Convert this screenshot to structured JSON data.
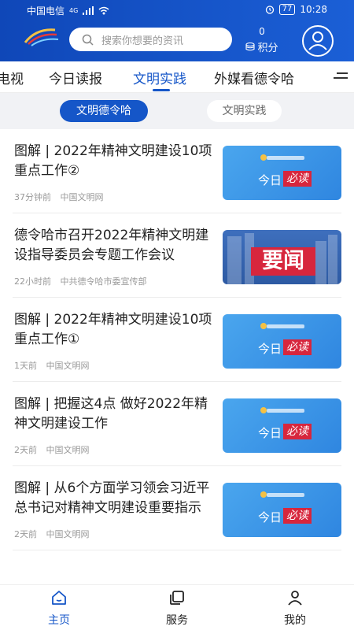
{
  "status_bar": {
    "carrier": "中国电信",
    "network": "4G",
    "battery": "77",
    "time": "10:28"
  },
  "header": {
    "search_placeholder": "搜索你想要的资讯",
    "points_value": "0",
    "points_label": "积分"
  },
  "nav": {
    "tabs": [
      {
        "label": "电视",
        "active": false
      },
      {
        "label": "今日读报",
        "active": false
      },
      {
        "label": "文明实践",
        "active": true
      },
      {
        "label": "外媒看德令哈",
        "active": false
      }
    ]
  },
  "subtabs": [
    {
      "label": "文明德令哈",
      "active": true
    },
    {
      "label": "文明实践",
      "active": false
    }
  ],
  "news": [
    {
      "title": "图解 | 2022年精神文明建设10项重点工作②",
      "time": "37分钟前",
      "source": "中国文明网",
      "thumb": "daily"
    },
    {
      "title": "德令哈市召开2022年精神文明建设指导委员会专题工作会议",
      "time": "22小时前",
      "source": "中共德令哈市委宣传部",
      "thumb": "news"
    },
    {
      "title": "图解 | 2022年精神文明建设10项重点工作①",
      "time": "1天前",
      "source": "中国文明网",
      "thumb": "daily"
    },
    {
      "title": "图解 | 把握这4点 做好2022年精神文明建设工作",
      "time": "2天前",
      "source": "中国文明网",
      "thumb": "daily"
    },
    {
      "title": "图解 | 从6个方面学习领会习近平总书记对精神文明建设重要指示",
      "time": "2天前",
      "source": "中国文明网",
      "thumb": "daily"
    }
  ],
  "thumbs": {
    "daily_day": "今日",
    "daily_read": "必读",
    "news_label": "要闻"
  },
  "bottom_nav": [
    {
      "label": "主页",
      "icon": "home-icon",
      "active": true
    },
    {
      "label": "服务",
      "icon": "service-icon",
      "active": false
    },
    {
      "label": "我的",
      "icon": "user-icon",
      "active": false
    }
  ],
  "colors": {
    "primary": "#1556c8",
    "header_bg": "#1b5fd6",
    "badge_red": "#d7263d"
  }
}
